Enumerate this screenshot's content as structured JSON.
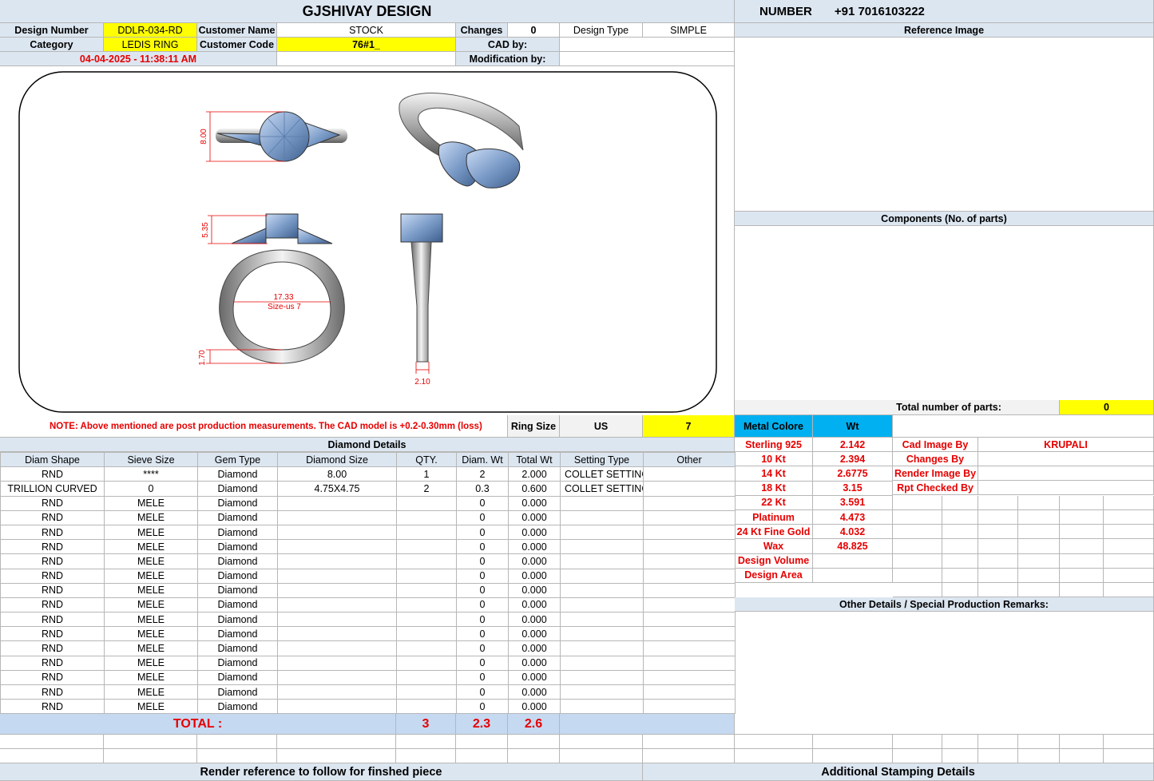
{
  "header": {
    "title": "GJSHIVAY DESIGN",
    "number_label": "NUMBER",
    "number_value": "+91 7016103222"
  },
  "info": {
    "design_number_label": "Design Number",
    "design_number": "DDLR-034-RD",
    "customer_name_label": "Customer Name",
    "customer_name": "STOCK",
    "changes_label": "Changes",
    "changes": "0",
    "design_type_label": "Design Type",
    "design_type": "SIMPLE",
    "category_label": "Category",
    "category": "LEDIS RING",
    "customer_code_label": "Customer Code",
    "customer_code": "76#1_",
    "cad_by_label": "CAD by:",
    "modification_by_label": "Modification by:",
    "timestamp": "04-04-2025 - 11:38:11 AM"
  },
  "drawing": {
    "dim_top": "8.00",
    "dim_head": "5.35",
    "dim_inner": "17.33",
    "dim_size": "Size-us 7",
    "dim_shank": "1.70",
    "dim_width": "2.10"
  },
  "right": {
    "reference_image": "Reference Image",
    "components": "Components (No. of parts)",
    "total_parts_label": "Total number of parts:",
    "total_parts": "0"
  },
  "note": {
    "text": "NOTE: Above mentioned are post production measurements. The CAD model is +0.2-0.30mm (loss)",
    "ring_size_label": "Ring Size",
    "ring_size_std": "US",
    "ring_size": "7"
  },
  "diamond": {
    "title": "Diamond Details",
    "columns": [
      "Diam Shape",
      "Sieve Size",
      "Gem Type",
      "Diamond Size",
      "QTY.",
      "Diam. Wt",
      "Total Wt",
      "Setting Type",
      "Other"
    ],
    "rows": [
      [
        "RND",
        "****",
        "Diamond",
        "8.00",
        "1",
        "2",
        "2.000",
        "COLLET SETTING",
        ""
      ],
      [
        "TRILLION CURVED",
        "0",
        "Diamond",
        "4.75X4.75",
        "2",
        "0.3",
        "0.600",
        "COLLET SETTING",
        ""
      ],
      [
        "RND",
        "MELE",
        "Diamond",
        "",
        "",
        "0",
        "0.000",
        "",
        ""
      ],
      [
        "RND",
        "MELE",
        "Diamond",
        "",
        "",
        "0",
        "0.000",
        "",
        ""
      ],
      [
        "RND",
        "MELE",
        "Diamond",
        "",
        "",
        "0",
        "0.000",
        "",
        ""
      ],
      [
        "RND",
        "MELE",
        "Diamond",
        "",
        "",
        "0",
        "0.000",
        "",
        ""
      ],
      [
        "RND",
        "MELE",
        "Diamond",
        "",
        "",
        "0",
        "0.000",
        "",
        ""
      ],
      [
        "RND",
        "MELE",
        "Diamond",
        "",
        "",
        "0",
        "0.000",
        "",
        ""
      ],
      [
        "RND",
        "MELE",
        "Diamond",
        "",
        "",
        "0",
        "0.000",
        "",
        ""
      ],
      [
        "RND",
        "MELE",
        "Diamond",
        "",
        "",
        "0",
        "0.000",
        "",
        ""
      ],
      [
        "RND",
        "MELE",
        "Diamond",
        "",
        "",
        "0",
        "0.000",
        "",
        ""
      ],
      [
        "RND",
        "MELE",
        "Diamond",
        "",
        "",
        "0",
        "0.000",
        "",
        ""
      ],
      [
        "RND",
        "MELE",
        "Diamond",
        "",
        "",
        "0",
        "0.000",
        "",
        ""
      ],
      [
        "RND",
        "MELE",
        "Diamond",
        "",
        "",
        "0",
        "0.000",
        "",
        ""
      ],
      [
        "RND",
        "MELE",
        "Diamond",
        "",
        "",
        "0",
        "0.000",
        "",
        ""
      ],
      [
        "RND",
        "MELE",
        "Diamond",
        "",
        "",
        "0",
        "0.000",
        "",
        ""
      ],
      [
        "RND",
        "MELE",
        "Diamond",
        "",
        "",
        "0",
        "0.000",
        "",
        ""
      ]
    ],
    "total_label": "TOTAL :",
    "total_qty": "3",
    "total_diam_wt": "2.3",
    "total_wt": "2.6"
  },
  "metal": {
    "header_color": "Metal Colore",
    "header_wt": "Wt",
    "rows": [
      [
        "Sterling 925",
        "2.142"
      ],
      [
        "10 Kt",
        "2.394"
      ],
      [
        "14 Kt",
        "2.6775"
      ],
      [
        "18 Kt",
        "3.15"
      ],
      [
        "22 Kt",
        "3.591"
      ],
      [
        "Platinum",
        "4.473"
      ],
      [
        "24 Kt Fine Gold",
        "4.032"
      ],
      [
        "Wax",
        "48.825"
      ],
      [
        "Design Volume",
        ""
      ],
      [
        "Design Area",
        ""
      ]
    ]
  },
  "credits": {
    "cad_image_by_label": "Cad Image By",
    "cad_image_by": "KRUPALI",
    "changes_by_label": "Changes By",
    "render_image_by_label": "Render Image By",
    "rpt_checked_by_label": "Rpt Checked By"
  },
  "other_details": "Other Details / Special Production Remarks:",
  "footer": {
    "render_reference": "Render reference to follow for finshed piece",
    "stamping": "Additional Stamping Details"
  },
  "colors": {
    "header_blue": "#dce6f1",
    "yellow": "#ffff00",
    "cyan": "#00b0f0",
    "red": "#e60000",
    "total_blue": "#c5d9f1"
  }
}
